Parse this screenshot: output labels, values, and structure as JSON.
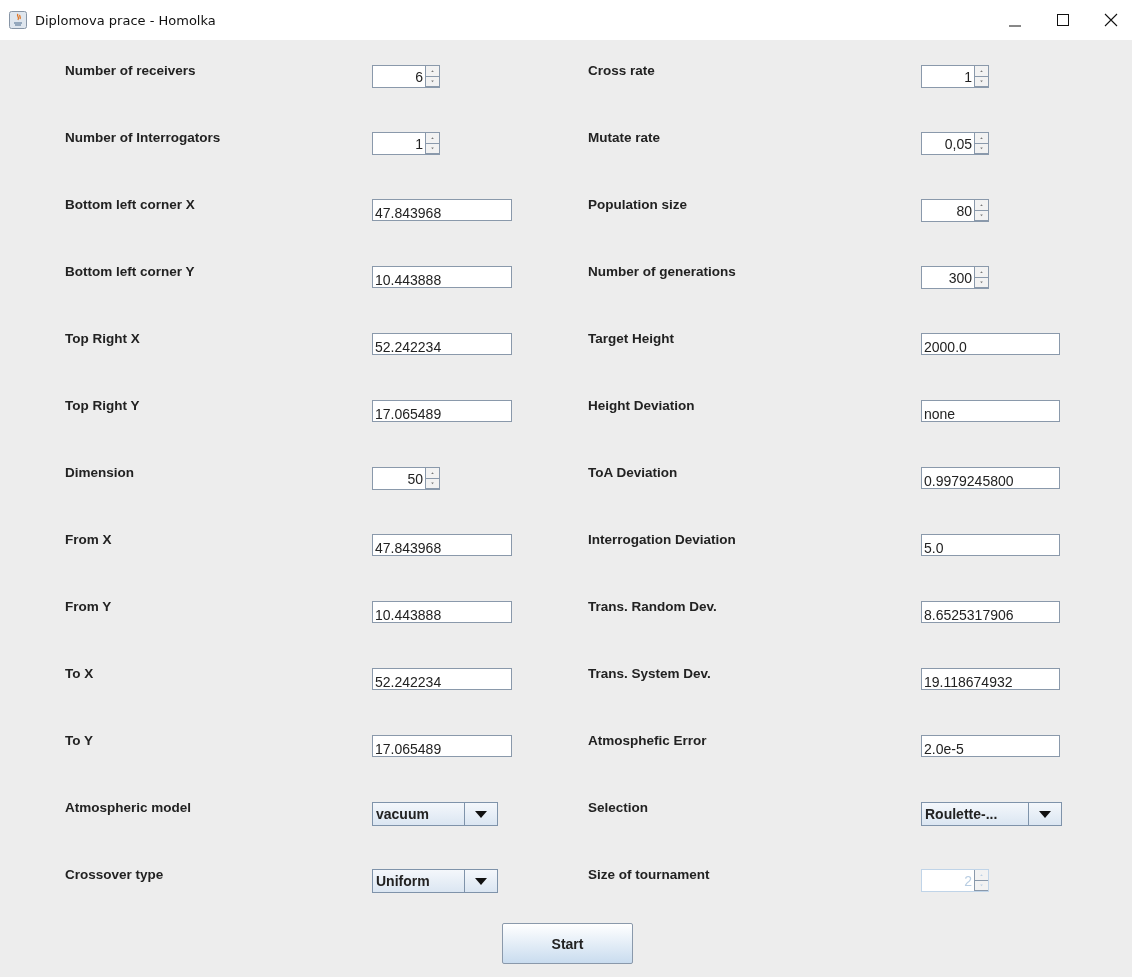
{
  "window": {
    "title": "Diplomova prace - Homolka"
  },
  "rows": [
    {
      "left": {
        "label": "Number of receivers",
        "kind": "spinner",
        "value": "6",
        "disabled": false
      },
      "right": {
        "label": "Cross rate",
        "kind": "spinner",
        "value": "1",
        "disabled": false
      }
    },
    {
      "left": {
        "label": "Number of Interrogators",
        "kind": "spinner",
        "value": "1",
        "disabled": false
      },
      "right": {
        "label": "Mutate rate",
        "kind": "spinner",
        "value": "0,05",
        "disabled": false
      }
    },
    {
      "left": {
        "label": "Bottom left corner X",
        "kind": "text",
        "value": "47.843968",
        "disabled": false
      },
      "right": {
        "label": "Population size",
        "kind": "spinner",
        "value": "80",
        "disabled": false
      }
    },
    {
      "left": {
        "label": "Bottom left corner Y",
        "kind": "text",
        "value": "10.443888",
        "disabled": false
      },
      "right": {
        "label": "Number of generations",
        "kind": "spinner",
        "value": "300",
        "disabled": false
      }
    },
    {
      "left": {
        "label": "Top Right X",
        "kind": "text",
        "value": "52.242234",
        "disabled": false
      },
      "right": {
        "label": "Target Height",
        "kind": "text",
        "value": "2000.0",
        "disabled": false
      }
    },
    {
      "left": {
        "label": "Top Right Y",
        "kind": "text",
        "value": "17.065489",
        "disabled": false
      },
      "right": {
        "label": "Height Deviation",
        "kind": "text",
        "value": "none",
        "disabled": false
      }
    },
    {
      "left": {
        "label": "Dimension",
        "kind": "spinner",
        "value": "50",
        "disabled": false
      },
      "right": {
        "label": "ToA Deviation",
        "kind": "text",
        "value": "0.9979245800",
        "disabled": false
      }
    },
    {
      "left": {
        "label": "From X",
        "kind": "text",
        "value": "47.843968",
        "disabled": false
      },
      "right": {
        "label": "Interrogation Deviation",
        "kind": "text",
        "value": "5.0",
        "disabled": false
      }
    },
    {
      "left": {
        "label": "From Y",
        "kind": "text",
        "value": "10.443888",
        "disabled": false
      },
      "right": {
        "label": "Trans. Random Dev.",
        "kind": "text",
        "value": "8.6525317906",
        "disabled": false
      }
    },
    {
      "left": {
        "label": "To X",
        "kind": "text",
        "value": "52.242234",
        "disabled": false
      },
      "right": {
        "label": "Trans. System Dev.",
        "kind": "text",
        "value": "19.118674932",
        "disabled": false
      }
    },
    {
      "left": {
        "label": "To Y",
        "kind": "text",
        "value": "17.065489",
        "disabled": false
      },
      "right": {
        "label": "Atmosphefic Error",
        "kind": "text",
        "value": "2.0e-5",
        "disabled": false
      }
    },
    {
      "left": {
        "label": "Atmospheric model",
        "kind": "combo",
        "value": "vacuum",
        "disabled": false
      },
      "right": {
        "label": "Selection",
        "kind": "combo",
        "value": "Roulette-...",
        "disabled": false
      }
    },
    {
      "left": {
        "label": "Crossover type",
        "kind": "combo",
        "value": "Uniform",
        "disabled": false
      },
      "right": {
        "label": "Size of tournament",
        "kind": "spinner",
        "value": "2",
        "disabled": true
      }
    }
  ],
  "start_button": {
    "label": "Start"
  }
}
